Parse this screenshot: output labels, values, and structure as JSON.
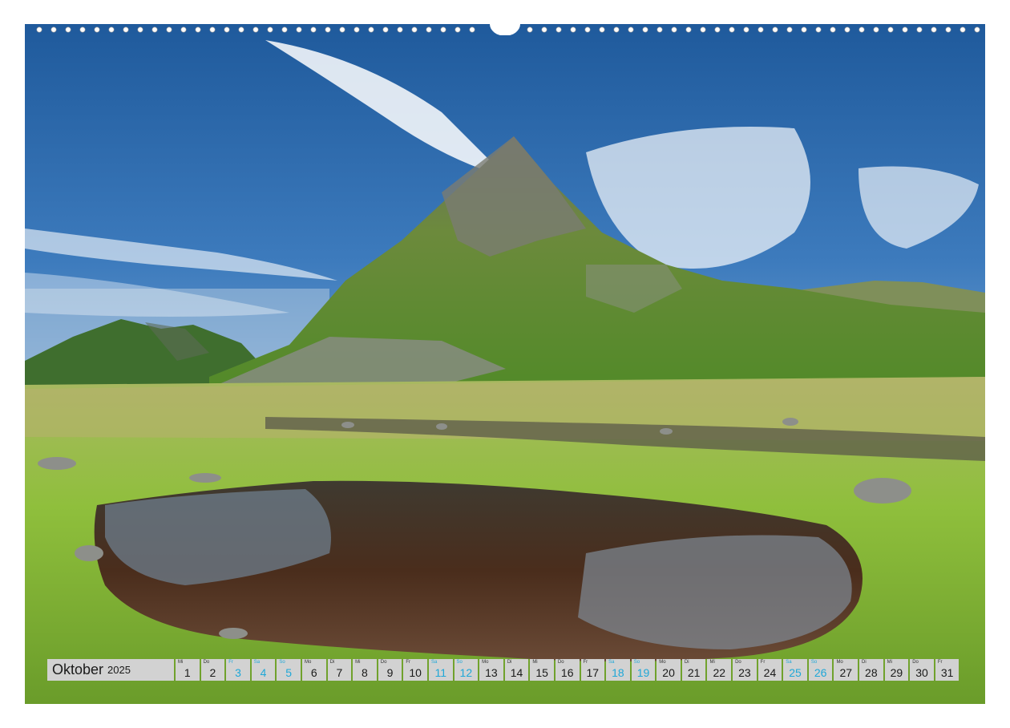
{
  "photo": {
    "subject": "mountain-peak-reflected-in-tarn"
  },
  "calendar": {
    "month": "Oktober",
    "year": "2025",
    "weekend_color": "#1fa7d8",
    "days": [
      {
        "wd": "Mi",
        "d": "1",
        "we": false
      },
      {
        "wd": "Do",
        "d": "2",
        "we": false
      },
      {
        "wd": "Fr",
        "d": "3",
        "we": true
      },
      {
        "wd": "Sa",
        "d": "4",
        "we": true
      },
      {
        "wd": "So",
        "d": "5",
        "we": true
      },
      {
        "wd": "Mo",
        "d": "6",
        "we": false
      },
      {
        "wd": "Di",
        "d": "7",
        "we": false
      },
      {
        "wd": "Mi",
        "d": "8",
        "we": false
      },
      {
        "wd": "Do",
        "d": "9",
        "we": false
      },
      {
        "wd": "Fr",
        "d": "10",
        "we": false
      },
      {
        "wd": "Sa",
        "d": "11",
        "we": true
      },
      {
        "wd": "So",
        "d": "12",
        "we": true
      },
      {
        "wd": "Mo",
        "d": "13",
        "we": false
      },
      {
        "wd": "Di",
        "d": "14",
        "we": false
      },
      {
        "wd": "Mi",
        "d": "15",
        "we": false
      },
      {
        "wd": "Do",
        "d": "16",
        "we": false
      },
      {
        "wd": "Fr",
        "d": "17",
        "we": false
      },
      {
        "wd": "Sa",
        "d": "18",
        "we": true
      },
      {
        "wd": "So",
        "d": "19",
        "we": true
      },
      {
        "wd": "Mo",
        "d": "20",
        "we": false
      },
      {
        "wd": "Di",
        "d": "21",
        "we": false
      },
      {
        "wd": "Mi",
        "d": "22",
        "we": false
      },
      {
        "wd": "Do",
        "d": "23",
        "we": false
      },
      {
        "wd": "Fr",
        "d": "24",
        "we": false
      },
      {
        "wd": "Sa",
        "d": "25",
        "we": true
      },
      {
        "wd": "So",
        "d": "26",
        "we": true
      },
      {
        "wd": "Mo",
        "d": "27",
        "we": false
      },
      {
        "wd": "Di",
        "d": "28",
        "we": false
      },
      {
        "wd": "Mi",
        "d": "29",
        "we": false
      },
      {
        "wd": "Do",
        "d": "30",
        "we": false
      },
      {
        "wd": "Fr",
        "d": "31",
        "we": false
      }
    ]
  }
}
